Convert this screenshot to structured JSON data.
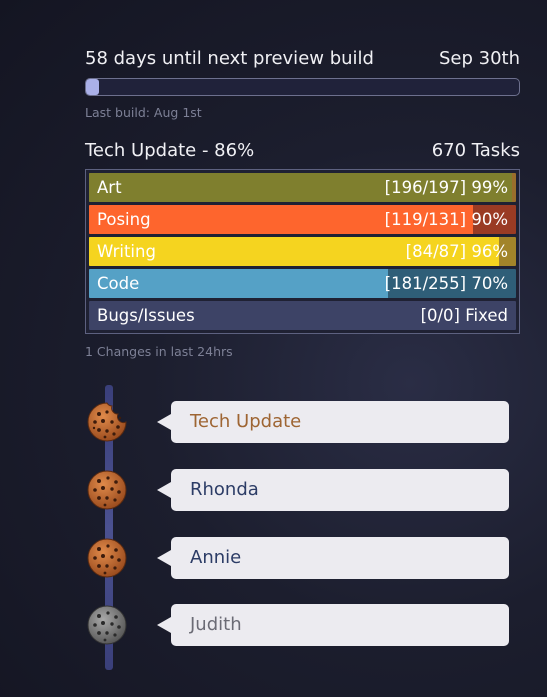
{
  "countdown": {
    "text": "58 days until next preview build",
    "date": "Sep 30th",
    "progress": 0.03
  },
  "last_build": "Last build: Aug 1st",
  "summary": {
    "title": "Tech Update - 86%",
    "tasks": "670 Tasks"
  },
  "tasks": [
    {
      "label": "Art",
      "value": "[196/197] 99%",
      "fraction": 0.99,
      "color": "#7f7f2e",
      "track": "#9a6e2c"
    },
    {
      "label": "Posing",
      "value": "[119/131] 90%",
      "fraction": 0.9,
      "color": "#fe652d",
      "track": "#9a3b24"
    },
    {
      "label": "Writing",
      "value": "[84/87] 96%",
      "fraction": 0.96,
      "color": "#f5d41f",
      "track": "#a2842a"
    },
    {
      "label": "Code",
      "value": "[181/255] 70%",
      "fraction": 0.7,
      "color": "#55a1c6",
      "track": "#2f5e78"
    },
    {
      "label": "Bugs/Issues",
      "value": "[0/0] Fixed",
      "fraction": 0.0,
      "color": "#3d4366",
      "track": "#3d4366"
    }
  ],
  "changes": "1 Changes in last 24hrs",
  "feed": [
    {
      "label": "Tech Update",
      "color": "#9e6533",
      "cookie": "bitten"
    },
    {
      "label": "Rhonda",
      "color": "#2c3c66",
      "cookie": "orange"
    },
    {
      "label": "Annie",
      "color": "#2c3c66",
      "cookie": "orange"
    },
    {
      "label": "Judith",
      "color": "#6b6b75",
      "cookie": "grey"
    }
  ]
}
